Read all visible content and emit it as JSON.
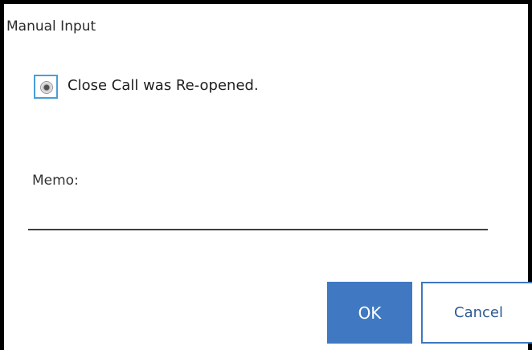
{
  "dialog": {
    "title": "Manual Input",
    "option": {
      "label": "Close Call was Re-opened.",
      "selected": true
    },
    "memo": {
      "label": "Memo:",
      "value": "",
      "placeholder": ""
    },
    "buttons": {
      "ok_label": "OK",
      "cancel_label": "Cancel"
    },
    "colors": {
      "ok_background": "#4079c2",
      "cancel_border": "#3f77bf",
      "radio_focus_border": "#4a9fd4"
    }
  }
}
